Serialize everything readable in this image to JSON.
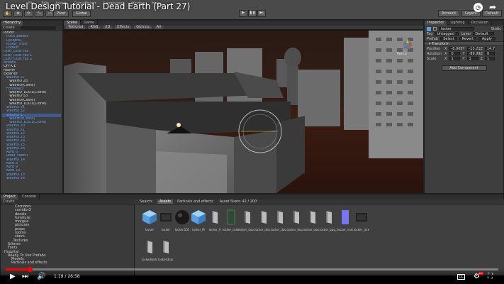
{
  "video": {
    "title": "Level Design Tutorial - Dead Earth (Part 27)",
    "time_current": "1:19",
    "time_total": "26:58",
    "progress": 0.049,
    "cc_label": "CC",
    "hd_badge": "HD"
  },
  "editor": {
    "menu": [
      "File",
      "Edit",
      "Assets",
      "GameObject",
      "Component",
      "Window",
      "Help"
    ],
    "pivot_label": "Pivot",
    "global_label": "Global",
    "account_label": "Account",
    "layers_label": "Layers",
    "layout_label": "Default"
  },
  "hierarchy": {
    "tabs": [
      "Hierarchy"
    ],
    "create_label": "Create",
    "items": [
      {
        "label": "locker",
        "c": "white",
        "d": 0
      },
      {
        "label": "Push_panels",
        "c": "blue",
        "d": 1
      },
      {
        "label": "Lockers1",
        "c": "blue",
        "d": 1
      },
      {
        "label": "locker_Trust",
        "c": "blue",
        "d": 1
      },
      {
        "label": "Lorouti",
        "c": "blue",
        "d": 1
      },
      {
        "label": "Dust_Dust Fall",
        "c": "blue",
        "d": 0
      },
      {
        "label": "Dust_Dust Fall 1",
        "c": "blue",
        "d": 0
      },
      {
        "label": "Dust_Dust Fall 2",
        "c": "blue",
        "d": 0
      },
      {
        "label": "Arrows",
        "c": "blue",
        "d": 0
      },
      {
        "label": "OFFICE",
        "c": "white",
        "d": 0
      },
      {
        "label": "room4",
        "c": "white",
        "d": 0
      },
      {
        "label": "Exterior",
        "c": "white",
        "d": 0
      },
      {
        "label": "WallHD 27",
        "c": "blue",
        "d": 1
      },
      {
        "label": "WallHD 28",
        "c": "white",
        "d": 2
      },
      {
        "label": "WallHD(Clone)",
        "c": "white",
        "d": 2
      },
      {
        "label": "Footway3",
        "c": "blue",
        "d": 1
      },
      {
        "label": "WallHD_LOD1(Clone)",
        "c": "white",
        "d": 2
      },
      {
        "label": "WallHD 33",
        "c": "white",
        "d": 2
      },
      {
        "label": "WallHD(Clone)",
        "c": "white",
        "d": 2
      },
      {
        "label": "WallHD_LOD1(Clone)",
        "c": "white",
        "d": 2
      },
      {
        "label": "WallHD 31",
        "c": "blue",
        "d": 1
      },
      {
        "label": "WallHD 32",
        "c": "blue",
        "d": 1
      },
      {
        "label": "WallHD 1",
        "c": "blue",
        "d": 1
      },
      {
        "label": "WallHD(Clone)",
        "c": "blue",
        "d": 2
      },
      {
        "label": "WallHD_LOD1(Clone)",
        "c": "blue",
        "d": 2
      },
      {
        "label": "WallHD 20",
        "c": "blue",
        "d": 1
      },
      {
        "label": "WallHD 21",
        "c": "blue",
        "d": 1
      },
      {
        "label": "WallHD 22",
        "c": "blue",
        "d": 1
      },
      {
        "label": "WallHD 23",
        "c": "blue",
        "d": 1
      },
      {
        "label": "WallHD 24",
        "c": "blue",
        "d": 1
      },
      {
        "label": "WallHD 25",
        "c": "blue",
        "d": 1
      },
      {
        "label": "WallHD 26",
        "c": "blue",
        "d": 1
      },
      {
        "label": "Kerb 6",
        "c": "blue",
        "d": 1
      },
      {
        "label": "Road_slabs7",
        "c": "blue",
        "d": 1
      },
      {
        "label": "WallHD 14",
        "c": "blue",
        "d": 1
      },
      {
        "label": "Kerb 8",
        "c": "blue",
        "d": 1
      },
      {
        "label": "Kerb 9",
        "c": "blue",
        "d": 1
      },
      {
        "label": "Kerb 10",
        "c": "blue",
        "d": 1
      },
      {
        "label": "WallHD 13",
        "c": "blue",
        "d": 1
      },
      {
        "label": "WallHD 34",
        "c": "blue",
        "d": 1
      }
    ]
  },
  "scene": {
    "tabs": [
      "Scene",
      "Game"
    ],
    "controls": [
      "Textured",
      "RGB",
      "2D",
      "Effects",
      "Gizmos",
      "All"
    ],
    "persp_label": "Persp"
  },
  "inspector": {
    "tabs": [
      "Inspector",
      "Lighting",
      "Occlusion"
    ],
    "object_name": "locker",
    "static_label": "Static",
    "tag_label": "Tag",
    "tag_value": "Untagged",
    "layer_label": "Layer",
    "layer_value": "Default",
    "prefab_label": "Prefab",
    "prefab_buttons": [
      "Select",
      "Revert",
      "Apply"
    ],
    "transform_label": "Transform",
    "position": {
      "label": "Position",
      "x": "-8.065",
      "y": "-13.21",
      "z": "14.7"
    },
    "rotation": {
      "label": "Rotation",
      "x": "0",
      "y": "-89.99",
      "z": "0"
    },
    "scale": {
      "label": "Scale",
      "x": "1",
      "y": "1",
      "z": "1"
    },
    "add_component": "Add Component"
  },
  "project": {
    "tabs": [
      "Project",
      "Console"
    ],
    "create_label": "Create",
    "tree": [
      {
        "label": "Corridors",
        "d": 3
      },
      {
        "label": "corridor3",
        "d": 3
      },
      {
        "label": "decals",
        "d": 3
      },
      {
        "label": "furniture",
        "d": 3
      },
      {
        "label": "morgue",
        "d": 3
      },
      {
        "label": "pictures",
        "d": 3
      },
      {
        "label": "props",
        "d": 3
      },
      {
        "label": "rooms",
        "d": 3
      },
      {
        "label": "stairs",
        "d": 3
      },
      {
        "label": "_Textures",
        "d": 2
      },
      {
        "label": "Scenes",
        "d": 1
      },
      {
        "label": "Fonts",
        "d": 1
      },
      {
        "label": "Hospital",
        "d": 0
      },
      {
        "label": "Ready To Use Prefabs",
        "d": 1
      },
      {
        "label": "Models",
        "d": 2
      },
      {
        "label": "Particals and effects",
        "d": 2
      }
    ],
    "asset_tabs": [
      "Search:",
      "Assets",
      "Particals and effects",
      "Asset Store: 42 / 200"
    ],
    "assets": [
      {
        "label": "locker",
        "kind": "cube"
      },
      {
        "label": "locker",
        "kind": "dark"
      },
      {
        "label": "locker-555",
        "kind": "sphere"
      },
      {
        "label": "locker_M",
        "kind": "cube"
      },
      {
        "label": "locker_A",
        "kind": "panel"
      },
      {
        "label": "locker_color",
        "kind": "green"
      },
      {
        "label": "locker_doo...",
        "kind": "panel"
      },
      {
        "label": "locker_doo...",
        "kind": "panel"
      },
      {
        "label": "locker_doo...",
        "kind": "panel"
      },
      {
        "label": "locker_doo...",
        "kind": "panel"
      },
      {
        "label": "locker_doo...",
        "kind": "panel"
      },
      {
        "label": "locker_bag...",
        "kind": "panel"
      },
      {
        "label": "locker_mat",
        "kind": "purple"
      },
      {
        "label": "locker_tare",
        "kind": "dark"
      },
      {
        "label": "lockerBods",
        "kind": "panel"
      },
      {
        "label": "lockerDoor",
        "kind": "panel"
      }
    ]
  }
}
